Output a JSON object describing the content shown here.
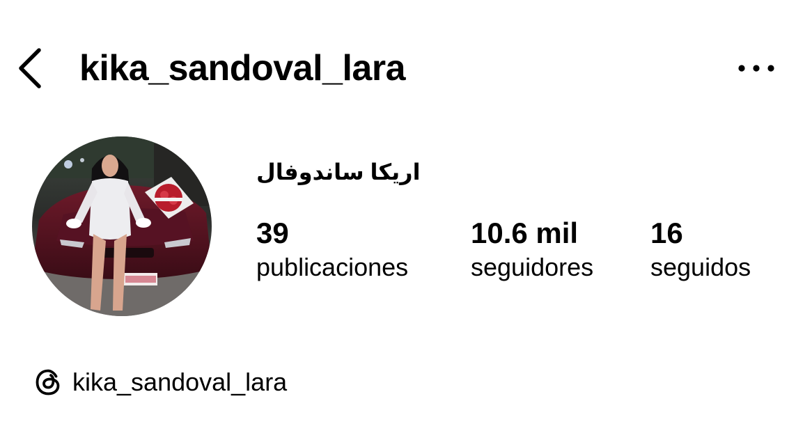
{
  "header": {
    "back_icon": "chevron-left-icon",
    "username": "kika_sandoval_lara",
    "more_icon": "ellipsis-horizontal-icon"
  },
  "profile": {
    "avatar_icon": "profile-photo",
    "full_name": "اريكا ساندوفال",
    "stats": {
      "posts": {
        "value": "39",
        "label": "publicaciones"
      },
      "followers": {
        "value": "10.6 mil",
        "label": "seguidores"
      },
      "following": {
        "value": "16",
        "label": "seguidos"
      }
    }
  },
  "threads": {
    "icon": "threads-icon",
    "username": "kika_sandoval_lara"
  }
}
